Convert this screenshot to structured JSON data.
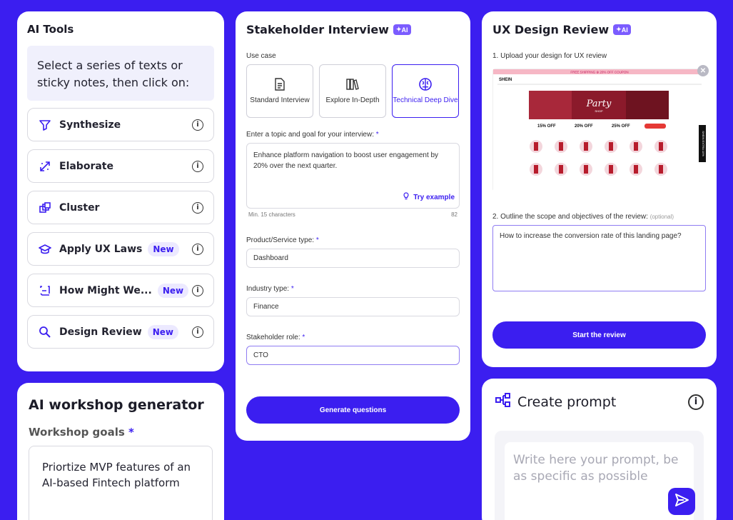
{
  "ai_tools": {
    "title": "AI Tools",
    "hint": "Select a series of texts or sticky notes, then click on:",
    "items": [
      {
        "label": "Synthesize",
        "badge": ""
      },
      {
        "label": "Elaborate",
        "badge": ""
      },
      {
        "label": "Cluster",
        "badge": ""
      },
      {
        "label": "Apply UX Laws",
        "badge": "New"
      },
      {
        "label": "How Might We...",
        "badge": "New"
      },
      {
        "label": "Design Review",
        "badge": "New"
      }
    ],
    "info_glyph": "i"
  },
  "workshop": {
    "title": "AI workshop generator",
    "goals_label": "Workshop goals",
    "required_mark": "*",
    "goals_value": "Priortize MVP features of an AI-based Fintech platform"
  },
  "stakeholder": {
    "title": "Stakeholder Interview",
    "ai_badge": "AI",
    "use_case_label": "Use case",
    "use_cases": [
      {
        "label": "Standard Interview",
        "active": false
      },
      {
        "label": "Explore In-Depth",
        "active": false
      },
      {
        "label": "Technical Deep Dive",
        "active": true
      }
    ],
    "topic_label": "Enter a topic and goal for your interview:",
    "required_mark": "*",
    "topic_value": "Enhance platform navigation to boost user engagement by 20% over the next quarter.",
    "try_example": "Try example",
    "min_chars": "Min. 15 characters",
    "char_count": "82",
    "product_label": "Product/Service type:",
    "product_value": "Dashboard",
    "industry_label": "Industry type:",
    "industry_value": "Finance",
    "role_label": "Stakeholder role:",
    "role_value": "CTO",
    "generate_button": "Generate questions"
  },
  "ux_review": {
    "title": "UX Design Review",
    "ai_badge": "AI",
    "upload_label": "1. Upload your design for UX review",
    "scope_label": "2. Outline the scope and objectives of the review:",
    "scope_optional": "(optional)",
    "scope_value": "How to increase the conversion rate of this landing page?",
    "start_button": "Start the review",
    "close_glyph": "✕",
    "preview": {
      "top_banner": "FREE SHIPPING  ⊕  20% OFF COUPON",
      "brand": "SHEIN",
      "hero_text": "Party",
      "hero_sub": "SHOP",
      "offers": [
        "15% OFF",
        "20% OFF",
        "25% OFF"
      ],
      "side_tab": "SHEIN EXTRA 10%"
    }
  },
  "create_prompt": {
    "title": "Create prompt",
    "placeholder": "Write here your prompt, be as specific as possible",
    "info_glyph": "i"
  },
  "colors": {
    "background": "#3b1ef0",
    "accent": "#3b1ef0",
    "badge_bg": "#ece9ff"
  }
}
